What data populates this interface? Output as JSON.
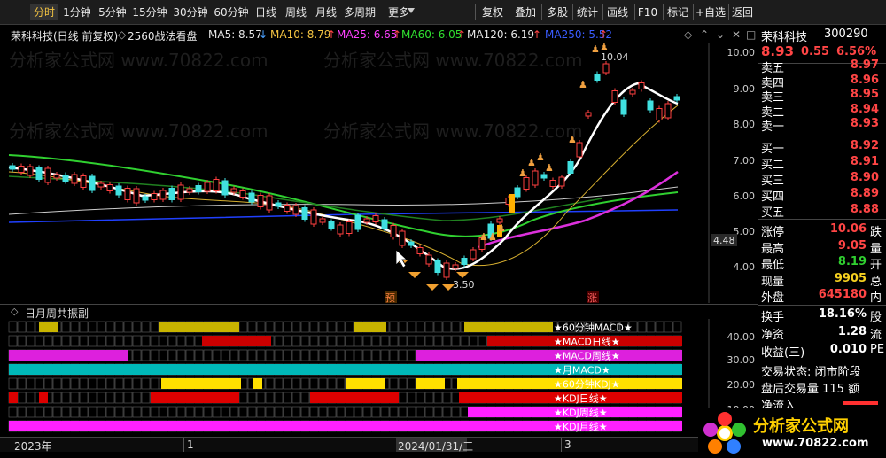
{
  "toolbar": {
    "periods": [
      "分时",
      "1分钟",
      "5分钟",
      "15分钟",
      "30分钟",
      "60分钟",
      "日线",
      "周线",
      "月线",
      "多周期",
      "更多"
    ],
    "right_buttons": [
      "复权",
      "叠加",
      "多股",
      "统计",
      "画线",
      "F10",
      "标记",
      "+自选",
      "返回"
    ]
  },
  "title": {
    "stock": "荣科科技(日线 前复权)",
    "formula": "2560战法看盘",
    "ma5": "MA5: 8.57",
    "ma10": "MA10: 8.79",
    "ma25": "MA25: 6.65",
    "ma60": "MA60: 6.05",
    "ma120": "MA120: 6.19",
    "ma250": "MA250: 5.52"
  },
  "chart": {
    "y_labels": [
      "10.00",
      "9.00",
      "8.00",
      "7.00",
      "6.00",
      "5.00",
      "4.00"
    ],
    "current_label": "4.48",
    "high_label": "10.04",
    "low_label": "3.50",
    "marker_yu": "预",
    "marker_zhang": "涨",
    "watermark": "分析家公式网 www.70822.com"
  },
  "subpanel": {
    "title": "日月周共振副",
    "y_labels": [
      "40.00",
      "30.00",
      "20.00",
      "10.00"
    ],
    "rows": [
      {
        "label": "★60分钟MACD★",
        "color": "#c8b400"
      },
      {
        "label": "★MACD日线★",
        "color": "#cc0000"
      },
      {
        "label": "★MACD周线★",
        "color": "#dd20dd"
      },
      {
        "label": "★月MACD★",
        "color": "#00b8b8"
      },
      {
        "label": "★60分钟KDJ★",
        "color": "#ffe000"
      },
      {
        "label": "★KDJ日线★",
        "color": "#dd0000"
      },
      {
        "label": "★KDJ周线★",
        "color": "#ff20ff"
      },
      {
        "label": "★KDJ月线★",
        "color": "#ff20ff"
      }
    ]
  },
  "axis": {
    "year": "2023年",
    "tick1": "1",
    "date": "2024/01/31/三",
    "tick3": "3"
  },
  "quote": {
    "name": "荣科科技",
    "code": "300290",
    "price": "8.93",
    "change": "0.55",
    "pct": "6.56%",
    "asks": [
      {
        "label": "卖五",
        "price": "8.97"
      },
      {
        "label": "卖四",
        "price": "8.96"
      },
      {
        "label": "卖三",
        "price": "8.95"
      },
      {
        "label": "卖二",
        "price": "8.94"
      },
      {
        "label": "卖一",
        "price": "8.93"
      }
    ],
    "bids": [
      {
        "label": "买一",
        "price": "8.92"
      },
      {
        "label": "买二",
        "price": "8.91"
      },
      {
        "label": "买三",
        "price": "8.90"
      },
      {
        "label": "买四",
        "price": "8.89"
      },
      {
        "label": "买五",
        "price": "8.88"
      }
    ],
    "stats": [
      {
        "label": "涨停",
        "value": "10.06",
        "suffix": "跌",
        "color": "red"
      },
      {
        "label": "最高",
        "value": "9.05",
        "suffix": "量",
        "color": "red"
      },
      {
        "label": "最低",
        "value": "8.19",
        "suffix": "开",
        "color": "grn"
      },
      {
        "label": "现量",
        "value": "9905",
        "suffix": "总",
        "color": "yel"
      },
      {
        "label": "外盘",
        "value": "645180",
        "suffix": "内",
        "color": "red"
      }
    ],
    "stats2": [
      {
        "label": "换手",
        "value": "18.16%",
        "suffix": "股"
      },
      {
        "label": "净资",
        "value": "1.28",
        "suffix": "流"
      },
      {
        "label": "收益(三)",
        "value": "0.010",
        "suffix": "PE"
      }
    ],
    "trade_status": "交易状态: 闭市阶段",
    "after_hours": "盘后交易量 115 额",
    "net_inflow": "净流入"
  },
  "logo": {
    "name": "分析家公式网",
    "url": "www.70822.com"
  }
}
